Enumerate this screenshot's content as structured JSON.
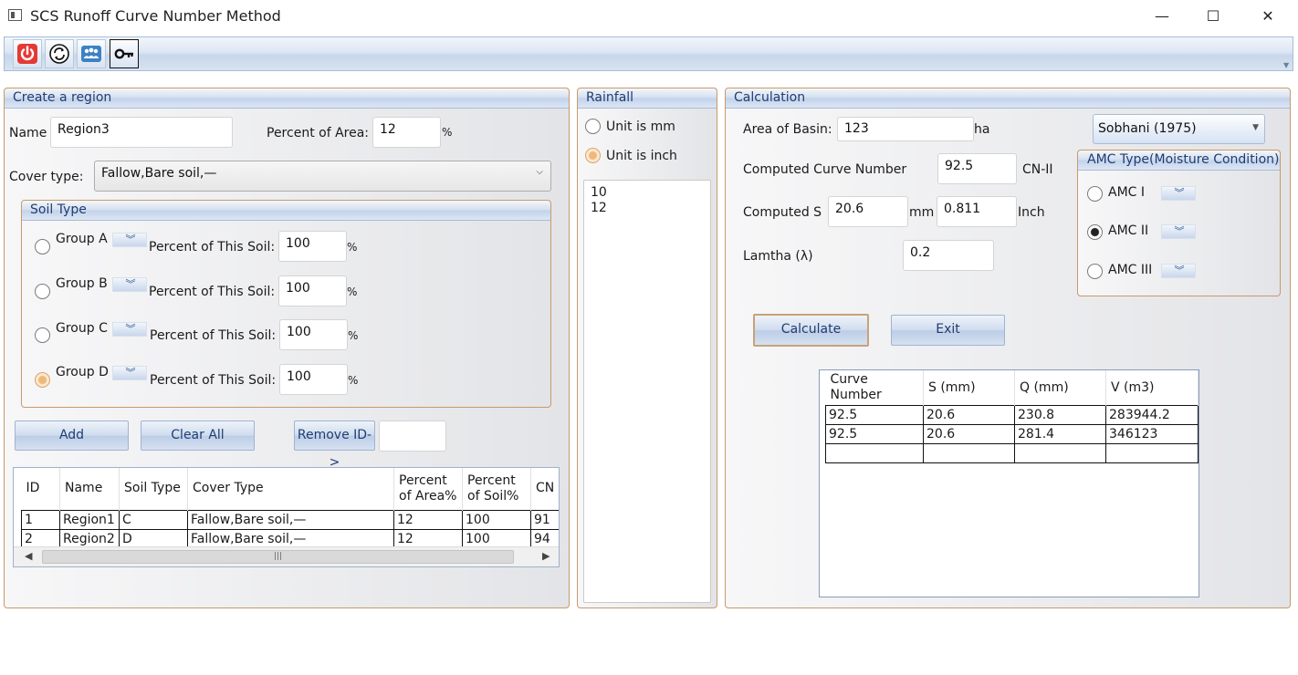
{
  "window": {
    "title": "SCS Runoff Curve Number Method",
    "minimize": "—",
    "maximize": "☐",
    "close": "✕"
  },
  "toolbar": {
    "icons": [
      "power-icon",
      "refresh-icon",
      "users-icon",
      "key-icon"
    ]
  },
  "region": {
    "title": "Create a region",
    "name_label": "Name",
    "name_value": "Region3",
    "percent_area_label": "Percent of Area:",
    "percent_area_value": "12",
    "percent_sign": "%",
    "cover_label": "Cover type:",
    "cover_value": "Fallow,Bare soil,—",
    "soil": {
      "title": "Soil Type",
      "groups": [
        {
          "label": "Group A",
          "percent_label": "Percent of This Soil:",
          "percent": "100",
          "sign": "%",
          "selected": false
        },
        {
          "label": "Group B",
          "percent_label": "Percent of This Soil:",
          "percent": "100",
          "sign": "%",
          "selected": false
        },
        {
          "label": "Group C",
          "percent_label": "Percent of This Soil:",
          "percent": "100",
          "sign": "%",
          "selected": false
        },
        {
          "label": "Group D",
          "percent_label": "Percent of This Soil:",
          "percent": "100",
          "sign": "%",
          "selected": true
        }
      ]
    },
    "buttons": {
      "add": "Add",
      "clear": "Clear All",
      "remove": "Remove ID->"
    },
    "remove_id_value": "",
    "table": {
      "headers": [
        "ID",
        "Name",
        "Soil Type",
        "Cover Type",
        "Percent of Area%",
        "Percent of Soil%",
        "CN"
      ],
      "rows": [
        [
          "1",
          "Region1",
          "C",
          "Fallow,Bare soil,—",
          "12",
          "100",
          "91"
        ],
        [
          "2",
          "Region2",
          "D",
          "Fallow,Bare soil,—",
          "12",
          "100",
          "94"
        ]
      ]
    }
  },
  "rainfall": {
    "title": "Rainfall",
    "unit_mm": "Unit is mm",
    "unit_inch": "Unit is inch",
    "selected_unit": "inch",
    "values": [
      "10",
      "12"
    ]
  },
  "calc": {
    "title": "Calculation",
    "area_label": "Area of Basin:",
    "area_value": "123",
    "area_unit": "ha",
    "method": "Sobhani (1975)",
    "cn_label": "Computed Curve Number",
    "cn_value": "92.5",
    "cn_unit": "CN-II",
    "s_label": "Computed S",
    "s_mm": "20.6",
    "mm_unit": "mm",
    "s_inch": "0.811",
    "inch_unit": "Inch",
    "lambda_label": "Lamtha (λ)",
    "lambda_value": "0.2",
    "amc": {
      "title": "AMC Type(Moisture Condition)",
      "options": [
        {
          "label": "AMC I",
          "selected": false
        },
        {
          "label": "AMC II",
          "selected": true
        },
        {
          "label": "AMC III",
          "selected": false
        }
      ]
    },
    "buttons": {
      "calculate": "Calculate",
      "exit": "Exit"
    },
    "results": {
      "headers": [
        "Curve Number",
        "S (mm)",
        "Q (mm)",
        "V (m3)"
      ],
      "rows": [
        [
          "92.5",
          "20.6",
          "230.8",
          "283944.2"
        ],
        [
          "92.5",
          "20.6",
          "281.4",
          "346123"
        ],
        [
          "",
          "",
          "",
          ""
        ]
      ]
    }
  }
}
